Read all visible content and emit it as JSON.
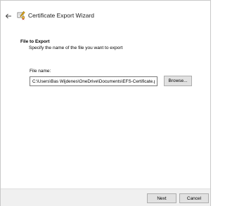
{
  "window": {
    "title": "Certificate Export Wizard",
    "back_icon": "arrow-left-icon",
    "app_icon": "certificate-wizard-icon"
  },
  "header": {
    "title": "File to Export",
    "subtitle": "Specify the name of the file you want to export"
  },
  "form": {
    "file_name_label": "File name:",
    "file_name_value": "C:\\Users\\Bas Wijdenes\\OneDrive\\Documents\\EFS-Certificate.pfx",
    "browse_label": "Browse..."
  },
  "footer": {
    "next_label": "Next",
    "cancel_label": "Cancel"
  },
  "colors": {
    "footer_background": "#f0f0f0",
    "button_background": "#e1e1e1",
    "button_border": "#adadad"
  }
}
